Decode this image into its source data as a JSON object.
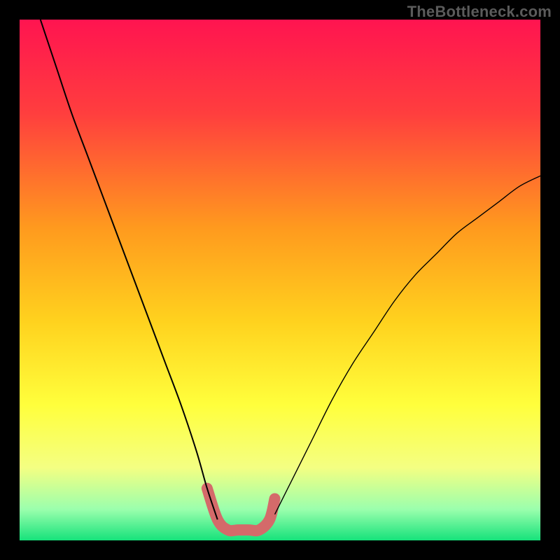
{
  "watermark": "TheBottleneck.com",
  "chart_data": {
    "type": "line",
    "title": "",
    "xlabel": "",
    "ylabel": "",
    "xlim": [
      0,
      100
    ],
    "ylim": [
      0,
      100
    ],
    "grid": false,
    "background": "rainbow-vertical-gradient",
    "series": [
      {
        "name": "left-curve",
        "stroke": "#000000",
        "stroke_width": 2,
        "x": [
          4,
          7,
          10,
          13,
          16,
          19,
          22,
          25,
          28,
          31,
          34,
          36,
          38
        ],
        "y": [
          100,
          91,
          82,
          74,
          66,
          58,
          50,
          42,
          34,
          26,
          17,
          10,
          4
        ]
      },
      {
        "name": "right-curve",
        "stroke": "#000000",
        "stroke_width": 1.4,
        "x": [
          49,
          52,
          56,
          60,
          64,
          68,
          72,
          76,
          80,
          84,
          88,
          92,
          96,
          100
        ],
        "y": [
          5,
          11,
          19,
          27,
          34,
          40,
          46,
          51,
          55,
          59,
          62,
          65,
          68,
          70
        ]
      },
      {
        "name": "highlight-segment",
        "stroke": "#d46a6a",
        "stroke_width": 16,
        "linecap": "round",
        "x": [
          36,
          38,
          40,
          42,
          44,
          46,
          48,
          49
        ],
        "y": [
          10,
          4,
          2,
          2,
          2,
          2,
          4,
          8
        ]
      }
    ],
    "gradient_stops": [
      {
        "offset": 0,
        "color": "#ff1450"
      },
      {
        "offset": 18,
        "color": "#ff3e3e"
      },
      {
        "offset": 40,
        "color": "#ff9a1e"
      },
      {
        "offset": 58,
        "color": "#ffd21e"
      },
      {
        "offset": 74,
        "color": "#ffff3c"
      },
      {
        "offset": 86,
        "color": "#f4ff82"
      },
      {
        "offset": 94,
        "color": "#9bffad"
      },
      {
        "offset": 100,
        "color": "#16e27b"
      }
    ]
  }
}
